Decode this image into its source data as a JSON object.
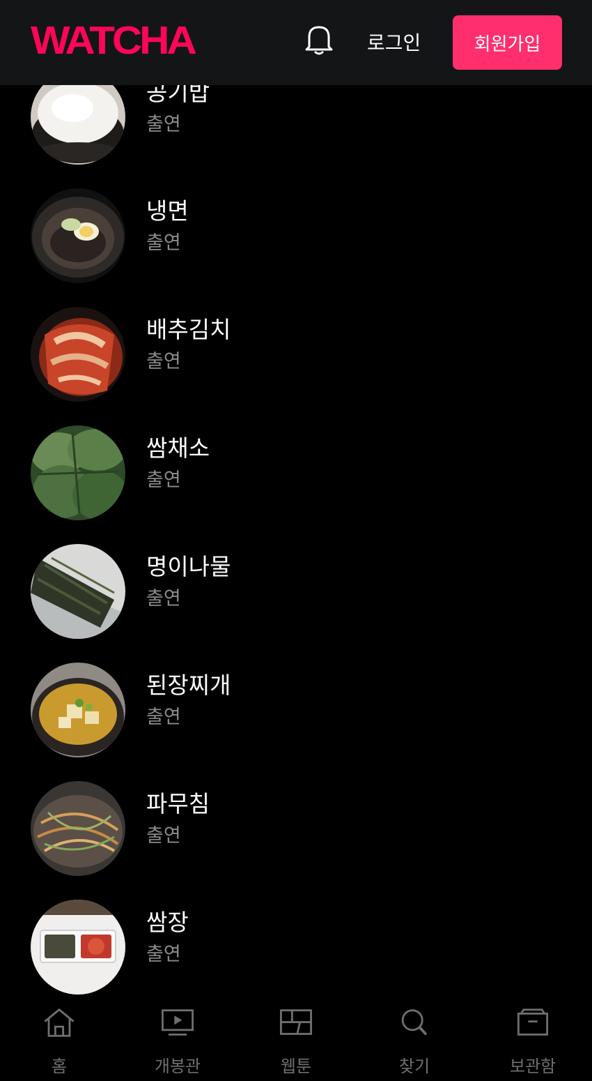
{
  "header": {
    "logo": "WATCHA",
    "login_label": "로그인",
    "signup_label": "회원가입",
    "accent_color": "#ff0558"
  },
  "cast": [
    {
      "name": "공기밥",
      "role": "출연",
      "icon": "rice-bowl-photo"
    },
    {
      "name": "냉면",
      "role": "출연",
      "icon": "naengmyeon-photo"
    },
    {
      "name": "배추김치",
      "role": "출연",
      "icon": "kimchi-photo"
    },
    {
      "name": "쌈채소",
      "role": "출연",
      "icon": "lettuce-photo"
    },
    {
      "name": "명이나물",
      "role": "출연",
      "icon": "myeongi-photo"
    },
    {
      "name": "된장찌개",
      "role": "출연",
      "icon": "doenjang-stew-photo"
    },
    {
      "name": "파무침",
      "role": "출연",
      "icon": "scallion-salad-photo"
    },
    {
      "name": "쌈장",
      "role": "출연",
      "icon": "ssamjang-photo"
    }
  ],
  "bottom_nav": [
    {
      "label": "홈",
      "icon": "home-icon"
    },
    {
      "label": "개봉관",
      "icon": "play-screen-icon"
    },
    {
      "label": "웹툰",
      "icon": "webtoon-icon"
    },
    {
      "label": "찾기",
      "icon": "search-icon"
    },
    {
      "label": "보관함",
      "icon": "archive-box-icon"
    }
  ]
}
